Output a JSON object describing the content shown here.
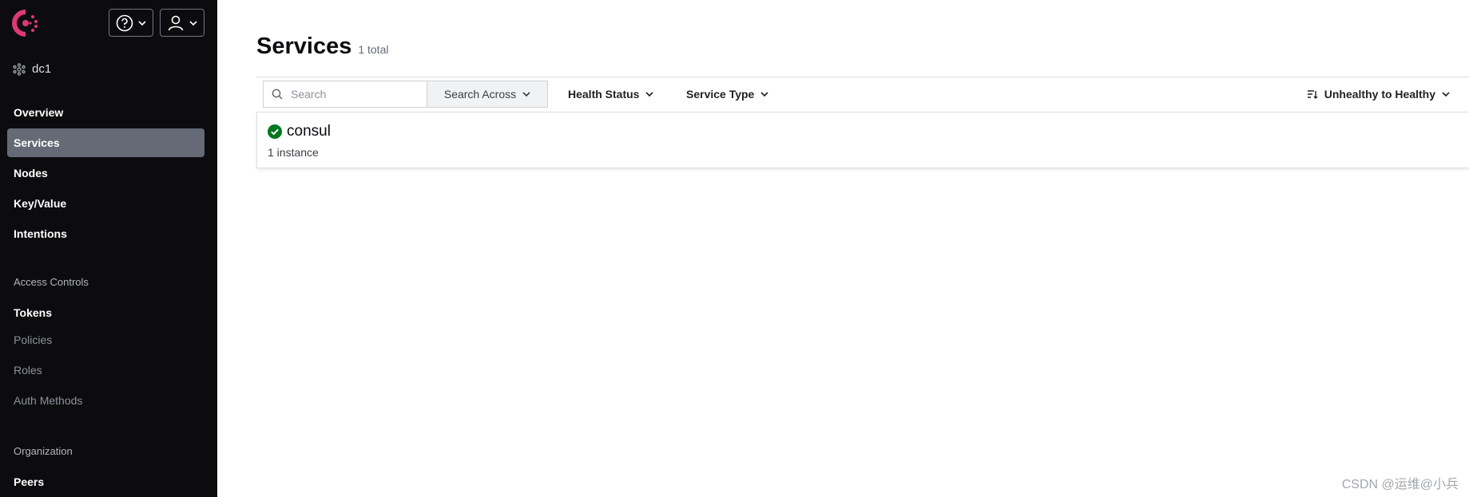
{
  "header": {
    "help_icon": "question-circle-icon",
    "user_icon": "user-icon"
  },
  "datacenter": {
    "name": "dc1",
    "icon": "datacenter-icon"
  },
  "nav": {
    "overview": "Overview",
    "services": "Services",
    "nodes": "Nodes",
    "key_value": "Key/Value",
    "intentions": "Intentions",
    "access_controls": "Access Controls",
    "tokens": "Tokens",
    "policies": "Policies",
    "roles": "Roles",
    "auth_methods": "Auth Methods",
    "organization": "Organization",
    "peers": "Peers"
  },
  "page": {
    "title": "Services",
    "total": "1 total"
  },
  "toolbar": {
    "search_placeholder": "Search",
    "search_across": "Search Across",
    "health_status": "Health Status",
    "service_type": "Service Type",
    "sort": "Unhealthy to Healthy"
  },
  "services": [
    {
      "name": "consul",
      "instances": "1 instance",
      "status": "passing"
    }
  ],
  "colors": {
    "brand": "#e03875",
    "sidebar_bg": "#0c0c0e",
    "active_bg": "#656a76",
    "healthy": "#00781e"
  },
  "watermark": "CSDN @运维@小兵"
}
